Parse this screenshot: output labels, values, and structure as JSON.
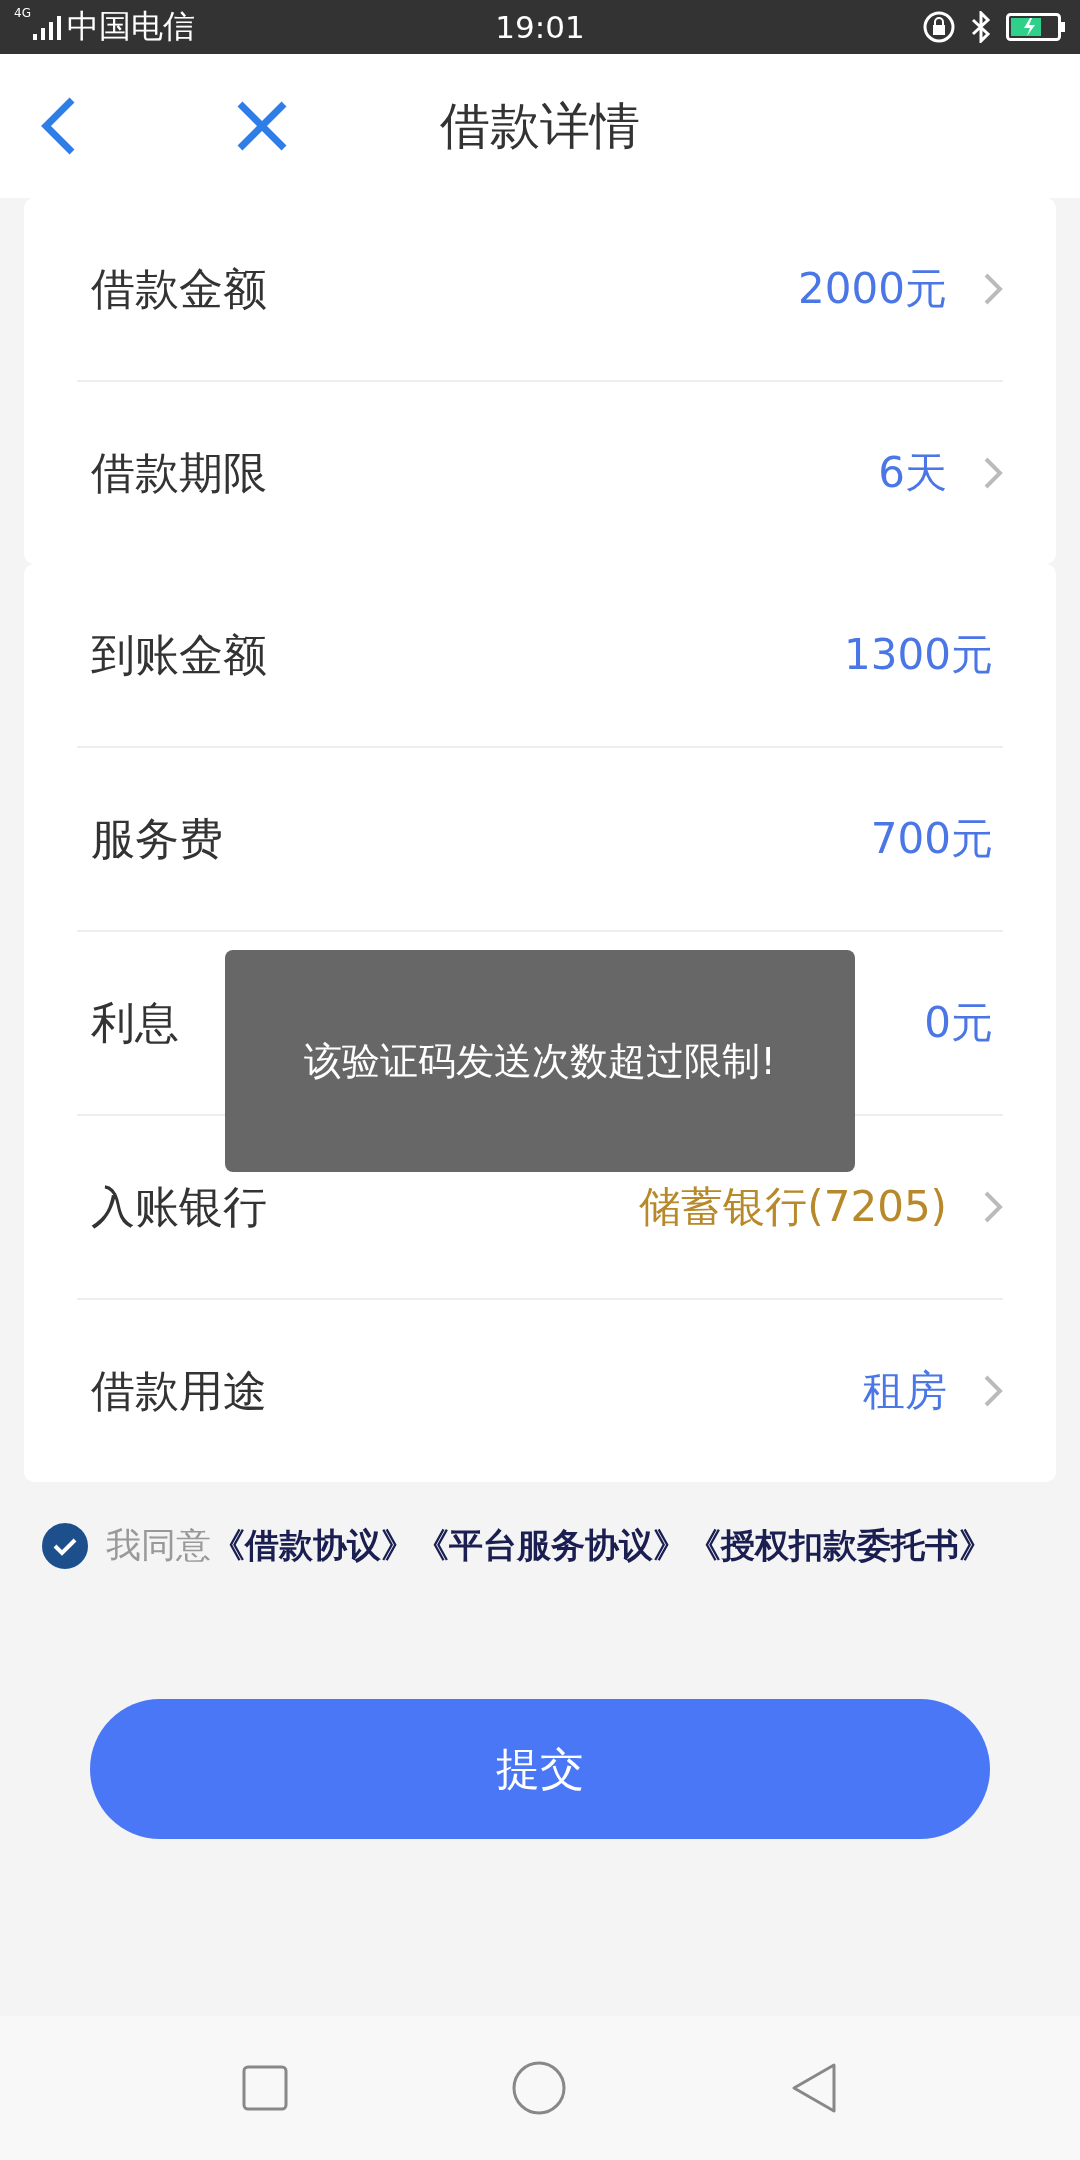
{
  "status_bar": {
    "network": "4G",
    "carrier": "中国电信",
    "time": "19:01"
  },
  "header": {
    "title": "借款详情"
  },
  "sections": [
    {
      "rows": [
        {
          "label": "借款金额",
          "value": "2000元",
          "color": "#4a76e6",
          "kind": "nav"
        },
        {
          "label": "借款期限",
          "value": "6天",
          "color": "#4a76e6",
          "kind": "nav"
        }
      ]
    },
    {
      "rows": [
        {
          "label": "到账金额",
          "value": "1300元",
          "color": "#4a76e6",
          "kind": "plain"
        },
        {
          "label": "服务费",
          "value": "700元",
          "color": "#4a76e6",
          "kind": "plain"
        },
        {
          "label": "利息",
          "value": "0元",
          "color": "#4a76e6",
          "kind": "plain"
        },
        {
          "label": "入账银行",
          "value": "储蓄银行(7205)",
          "color": "#b8892a",
          "kind": "nav"
        },
        {
          "label": "借款用途",
          "value": "租房",
          "color": "#4a76e6",
          "kind": "nav"
        }
      ]
    }
  ],
  "agreement": {
    "checked": true,
    "text": "我同意",
    "links": [
      "《借款协议》",
      "《平台服务协议》",
      "《授权扣款委托书》"
    ]
  },
  "submit_button": "提交",
  "toast": "该验证码发送次数超过限制!"
}
